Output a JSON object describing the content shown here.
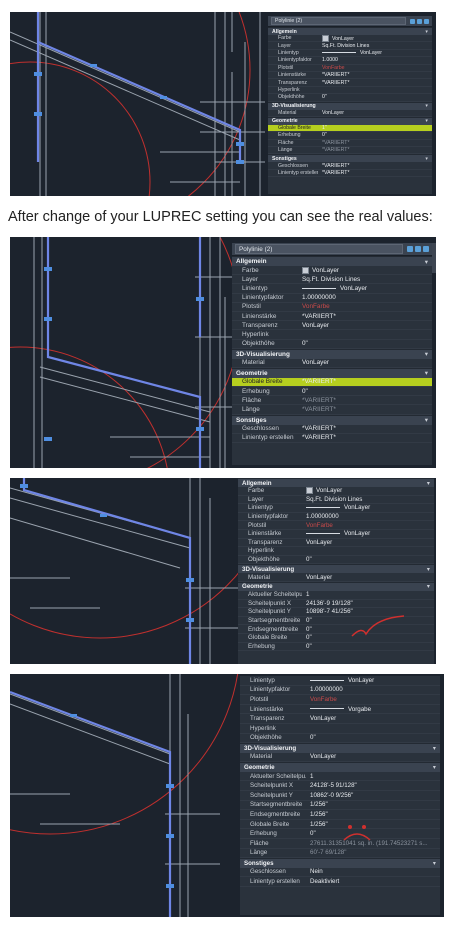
{
  "caption": "After change of your LUPREC setting you can see the real values:",
  "panel1": {
    "selector": "Polylinie (2)",
    "sections": [
      {
        "title": "Allgemein",
        "rows": [
          {
            "k": "Farbe",
            "v": "VonLayer",
            "swatch": true
          },
          {
            "k": "Layer",
            "v": "Sq.Ft. Division Lines"
          },
          {
            "k": "Linientyp",
            "v": "VonLayer",
            "line": true
          },
          {
            "k": "Linientypfaktor",
            "v": "1.0000"
          },
          {
            "k": "Plotstil",
            "v": "VonFarbe",
            "red": true
          },
          {
            "k": "Linienstärke",
            "v": "*VARIIERT*"
          },
          {
            "k": "Transparenz",
            "v": "*VARIIERT*"
          },
          {
            "k": "Hyperlink",
            "v": ""
          },
          {
            "k": "Objekthöhe",
            "v": "0\""
          }
        ]
      },
      {
        "title": "3D-Visualisierung",
        "rows": [
          {
            "k": "Material",
            "v": "VonLayer"
          }
        ]
      },
      {
        "title": "Geometrie",
        "rows": [
          {
            "k": "Globale Breite",
            "v": "1\"",
            "highlight": true
          },
          {
            "k": "Erhebung",
            "v": "0\""
          },
          {
            "k": "Fläche",
            "v": "*VARIIERT*",
            "dim": true
          },
          {
            "k": "Länge",
            "v": "*VARIIERT*",
            "dim": true
          }
        ]
      },
      {
        "title": "Sonstiges",
        "rows": [
          {
            "k": "Geschlossen",
            "v": "*VARIIERT*"
          },
          {
            "k": "Linientyp erstellen",
            "v": "*VARIIERT*"
          }
        ]
      }
    ]
  },
  "panel2": {
    "selector": "Polylinie (2)",
    "sections": [
      {
        "title": "Allgemein",
        "rows": [
          {
            "k": "Farbe",
            "v": "VonLayer",
            "swatch": true
          },
          {
            "k": "Layer",
            "v": "Sq.Ft. Division Lines"
          },
          {
            "k": "Linientyp",
            "v": "VonLayer",
            "line": true
          },
          {
            "k": "Linientypfaktor",
            "v": "1.00000000"
          },
          {
            "k": "Plotstil",
            "v": "VonFarbe",
            "red": true
          },
          {
            "k": "Linienstärke",
            "v": "*VARIIERT*"
          },
          {
            "k": "Transparenz",
            "v": "VonLayer"
          },
          {
            "k": "Hyperlink",
            "v": ""
          },
          {
            "k": "Objekthöhe",
            "v": "0\""
          }
        ]
      },
      {
        "title": "3D-Visualisierung",
        "rows": [
          {
            "k": "Material",
            "v": "VonLayer"
          }
        ]
      },
      {
        "title": "Geometrie",
        "rows": [
          {
            "k": "Globale Breite",
            "v": "*VARIIERT*",
            "highlight": true
          },
          {
            "k": "Erhebung",
            "v": "0\""
          },
          {
            "k": "Fläche",
            "v": "*VARIIERT*",
            "dim": true
          },
          {
            "k": "Länge",
            "v": "*VARIIERT*",
            "dim": true
          }
        ]
      },
      {
        "title": "Sonstiges",
        "rows": [
          {
            "k": "Geschlossen",
            "v": "*VARIIERT*"
          },
          {
            "k": "Linientyp erstellen",
            "v": "*VARIIERT*"
          }
        ]
      }
    ]
  },
  "panel3": {
    "sections": [
      {
        "title": "Allgemein",
        "rows": [
          {
            "k": "Farbe",
            "v": "VonLayer",
            "swatch": true
          },
          {
            "k": "Layer",
            "v": "Sq.Ft. Division Lines"
          },
          {
            "k": "Linientyp",
            "v": "VonLayer",
            "line": true
          },
          {
            "k": "Linientypfaktor",
            "v": "1.00000000"
          },
          {
            "k": "Plotstil",
            "v": "VonFarbe",
            "red": true
          },
          {
            "k": "Linienstärke",
            "v": "VonLayer",
            "line": true
          },
          {
            "k": "Transparenz",
            "v": "VonLayer"
          },
          {
            "k": "Hyperlink",
            "v": ""
          },
          {
            "k": "Objekthöhe",
            "v": "0\""
          }
        ]
      },
      {
        "title": "3D-Visualisierung",
        "rows": [
          {
            "k": "Material",
            "v": "VonLayer"
          }
        ]
      },
      {
        "title": "Geometrie",
        "rows": [
          {
            "k": "Aktueller Scheitelpu...",
            "v": "1"
          },
          {
            "k": "Scheitelpunkt X",
            "v": "24136'-9 19/128\""
          },
          {
            "k": "Scheitelpunkt Y",
            "v": "10898'-7 41/256\""
          },
          {
            "k": "Startsegmentbreite",
            "v": "0\""
          },
          {
            "k": "Endsegmentbreite",
            "v": "0\""
          },
          {
            "k": "Globale Breite",
            "v": "0\""
          },
          {
            "k": "Erhebung",
            "v": "0\""
          }
        ]
      }
    ]
  },
  "panel4": {
    "sections": [
      {
        "title": "",
        "rows": [
          {
            "k": "Linientyp",
            "v": "VonLayer",
            "line": true
          },
          {
            "k": "Linientypfaktor",
            "v": "1.00000000"
          },
          {
            "k": "Plotstil",
            "v": "VonFarbe",
            "red": true
          },
          {
            "k": "Linienstärke",
            "v": "Vorgabe",
            "line": true
          },
          {
            "k": "Transparenz",
            "v": "VonLayer"
          },
          {
            "k": "Hyperlink",
            "v": ""
          },
          {
            "k": "Objekthöhe",
            "v": "0\""
          }
        ]
      },
      {
        "title": "3D-Visualisierung",
        "rows": [
          {
            "k": "Material",
            "v": "VonLayer"
          }
        ]
      },
      {
        "title": "Geometrie",
        "rows": [
          {
            "k": "Aktuelter Scheitelpu...",
            "v": "1"
          },
          {
            "k": "Scheitelpunkt X",
            "v": "24128'-5 91/128\""
          },
          {
            "k": "Scheitelpunkt Y",
            "v": "10862'-0 9/256\""
          },
          {
            "k": "Startsegmentbreite",
            "v": "1/256\""
          },
          {
            "k": "Endsegmentbreite",
            "v": "1/256\""
          },
          {
            "k": "Globale Breite",
            "v": "1/256\""
          },
          {
            "k": "Erhebung",
            "v": "0\""
          },
          {
            "k": "Fläche",
            "v": "27611.31351041 sq. in. (191.74523271 s...",
            "dim": true
          },
          {
            "k": "Länge",
            "v": "60'-7 69/128\"",
            "dim": true
          }
        ]
      },
      {
        "title": "Sonstiges",
        "rows": [
          {
            "k": "Geschlossen",
            "v": "Nein"
          },
          {
            "k": "Linientyp erstellen",
            "v": "Deaktiviert"
          }
        ]
      }
    ]
  },
  "colors": {
    "canvas": "#1c232d",
    "panel": "#2a323c",
    "highlight": "#b6cf1f",
    "selection": "#6f86e6",
    "redline": "#c0302e"
  }
}
